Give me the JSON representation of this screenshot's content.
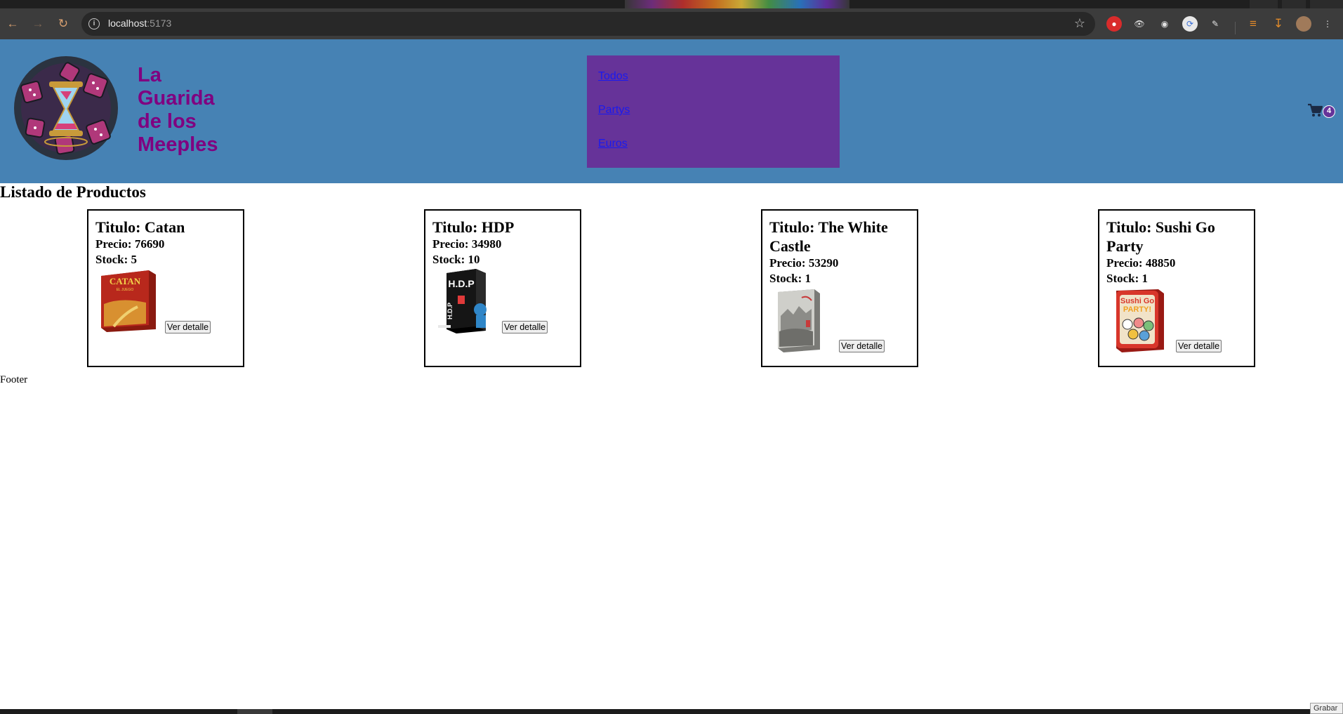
{
  "browser": {
    "url_host": "localhost",
    "url_port": ":5173"
  },
  "header": {
    "brand_lines": [
      "La",
      "Guarida",
      "de los",
      "Meeples"
    ],
    "nav": [
      "Todos",
      "Partys",
      "Euros"
    ],
    "cart_count": "4"
  },
  "main": {
    "title": "Listado de Productos",
    "products": [
      {
        "title": "Titulo: Catan",
        "price": "Precio: 76690",
        "stock": "Stock: 5",
        "button": "Ver detalle",
        "box_color": "#b8281c"
      },
      {
        "title": "Titulo: HDP",
        "price": "Precio: 34980",
        "stock": "Stock: 10",
        "button": "Ver detalle",
        "box_color": "#111111"
      },
      {
        "title": "Titulo: The White Castle",
        "price": "Precio: 53290",
        "stock": "Stock: 1",
        "button": "Ver detalle",
        "box_color": "#9a9a96"
      },
      {
        "title": "Titulo: Sushi Go Party",
        "price": "Precio: 48850",
        "stock": "Stock: 1",
        "button": "Ver detalle",
        "box_color": "#d8362a"
      }
    ]
  },
  "footer": {
    "text": "Footer"
  },
  "bottom": {
    "record_label": "Grabar"
  },
  "colors": {
    "header_bg": "#4682b4",
    "nav_bg": "#663399",
    "brand": "#800080",
    "link": "#1a1aee"
  }
}
